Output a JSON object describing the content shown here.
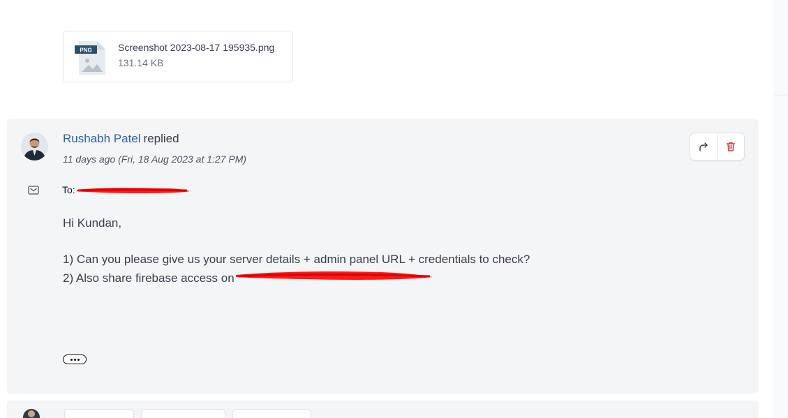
{
  "attachment": {
    "badge": "PNG",
    "file_name": "Screenshot 2023-08-17 195935.png",
    "file_size": "131.14 KB"
  },
  "reply": {
    "author": "Rushabh Patel",
    "verb": "replied",
    "timestamp": "11 days ago (Fri, 18 Aug 2023 at 1:27 PM)",
    "to_label": "To:",
    "body": {
      "greeting": "Hi Kundan,",
      "line1": "1) Can you please give us your server details + admin panel URL + credentials to check?",
      "line2": "2) Also share firebase access on"
    },
    "actions": [
      {
        "icon": "forward-icon"
      },
      {
        "icon": "trash-icon"
      }
    ]
  },
  "colors": {
    "author": "#2f5fb3",
    "card_bg": "#f4f5f7",
    "delete": "#d9363e",
    "redaction": "#ff0000"
  }
}
